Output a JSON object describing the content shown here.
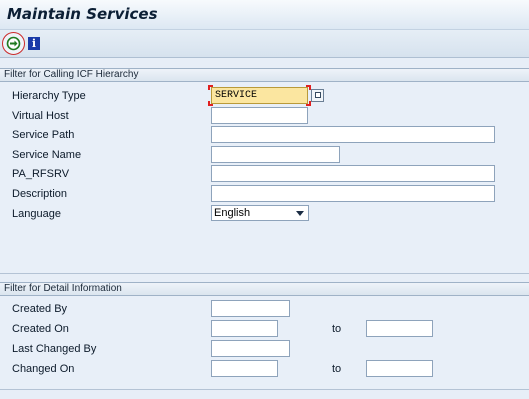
{
  "window": {
    "title": "Maintain Services"
  },
  "toolbar": {
    "execute_icon": "execute-icon",
    "info_icon": "info-icon",
    "info_glyph": "i"
  },
  "section1": {
    "header": "Filter for Calling ICF Hierarchy",
    "fields": {
      "hierarchy_type": {
        "label": "Hierarchy Type",
        "value": "SERVICE"
      },
      "virtual_host": {
        "label": "Virtual Host",
        "value": ""
      },
      "service_path": {
        "label": "Service Path",
        "value": ""
      },
      "service_name": {
        "label": "Service Name",
        "value": ""
      },
      "pa_rfsrv": {
        "label": "PA_RFSRV",
        "value": ""
      },
      "description": {
        "label": "Description",
        "value": ""
      },
      "language": {
        "label": "Language",
        "value": "English"
      }
    }
  },
  "section2": {
    "header": "Filter for Detail Information",
    "fields": {
      "created_by": {
        "label": "Created By",
        "value": ""
      },
      "created_on": {
        "label": "Created On",
        "value": "",
        "to_label": "to",
        "to_value": ""
      },
      "last_changed_by": {
        "label": "Last Changed By",
        "value": ""
      },
      "changed_on": {
        "label": "Changed On",
        "value": "",
        "to_label": "to",
        "to_value": ""
      }
    }
  },
  "colors": {
    "focus_field": "#fbe6a0",
    "execute_ring": "#cc2a2a",
    "info_badge": "#1a3aa8"
  }
}
